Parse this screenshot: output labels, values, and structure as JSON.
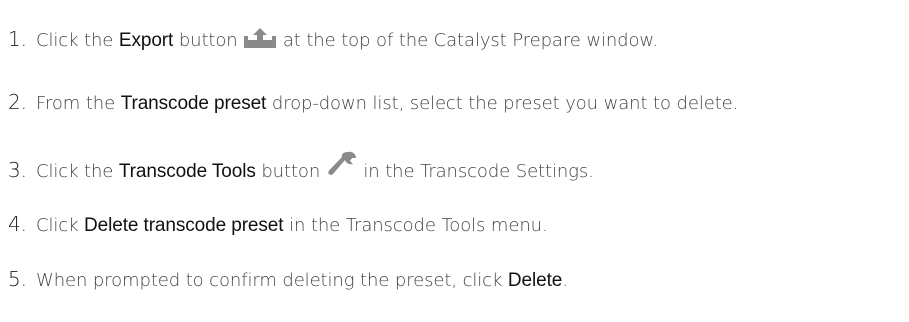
{
  "steps": [
    {
      "number": "1.",
      "text_before": "Click the ",
      "bold": "Export",
      "text_mid": " button ",
      "icon": "export-upload-icon",
      "text_after": " at the top of the Catalyst Prepare window."
    },
    {
      "number": "2.",
      "text_before": "From the ",
      "bold": "Transcode preset",
      "text_after": " drop-down list, select the preset you want to delete."
    },
    {
      "number": "3.",
      "text_before": "Click the ",
      "bold": "Transcode Tools",
      "text_mid": " button ",
      "icon": "wrench-icon",
      "text_after": " in the Transcode Settings."
    },
    {
      "number": "4.",
      "text_before": "Click ",
      "bold": "Delete transcode preset",
      "text_after": " in the Transcode Tools menu."
    },
    {
      "number": "5.",
      "text_before": "When prompted to confirm deleting the preset, click ",
      "bold": "Delete",
      "text_after": "."
    }
  ],
  "colors": {
    "text": "#3a3a3a",
    "bold_text": "#111111",
    "icon_gray": "#8a8a8a"
  }
}
